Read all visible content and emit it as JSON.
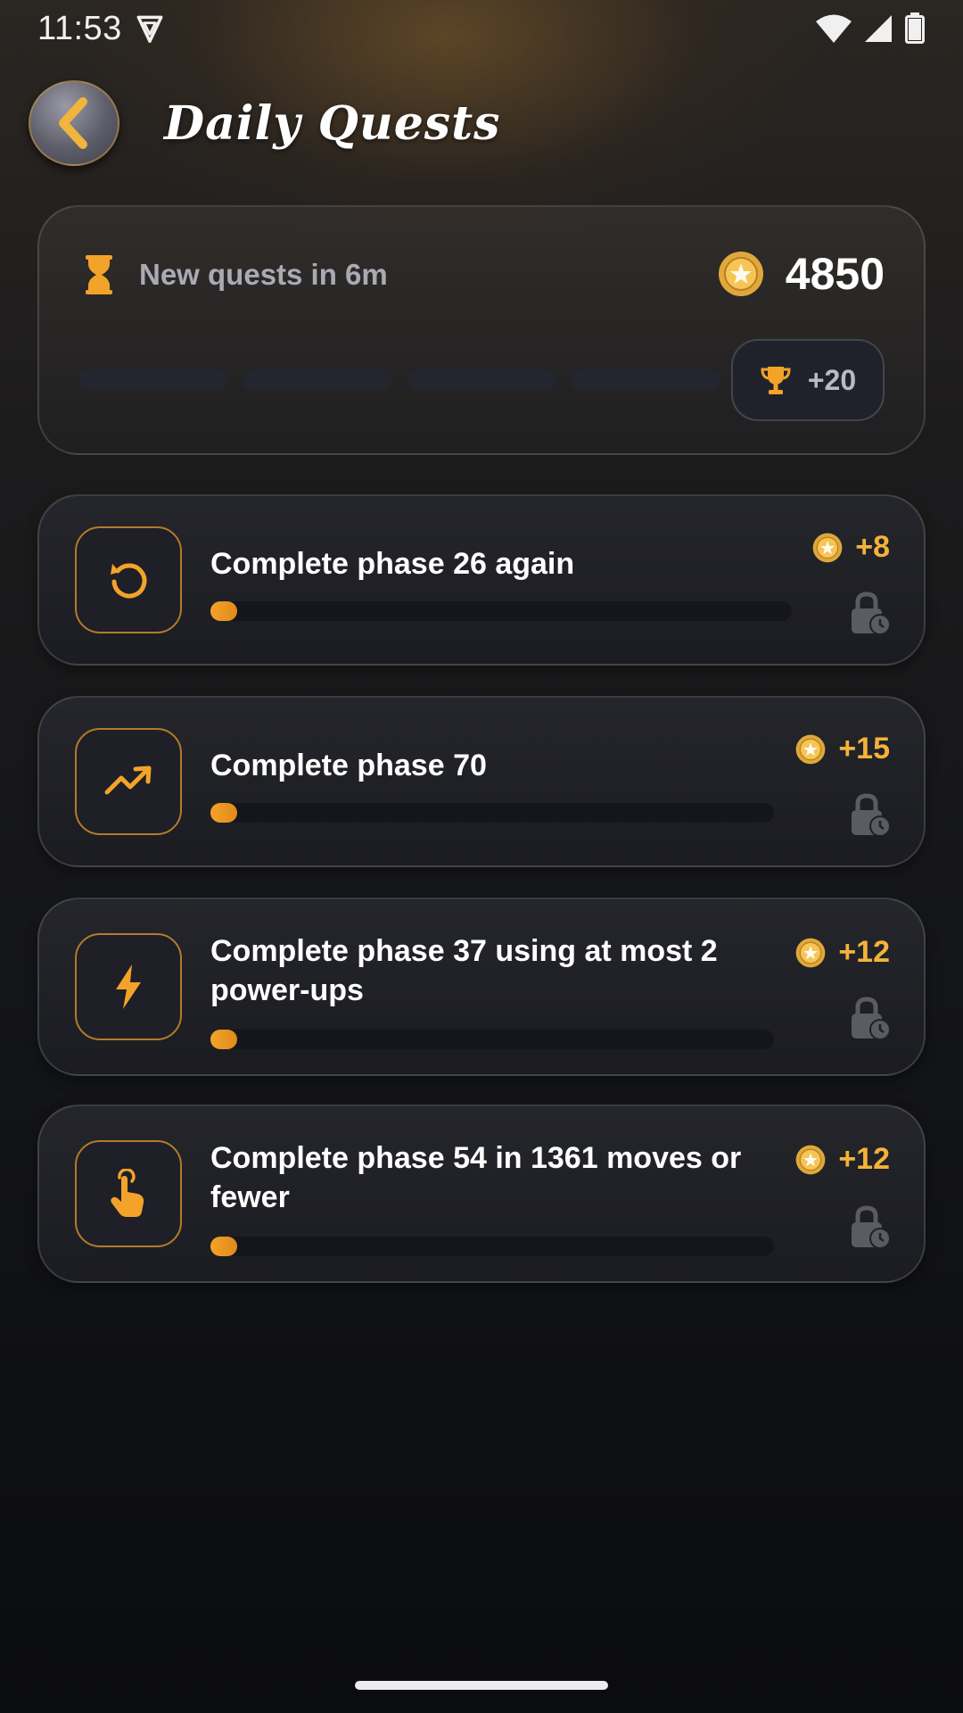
{
  "status_bar": {
    "time": "11:53"
  },
  "header": {
    "title": "Daily Quests",
    "back_icon": "chevron-left-icon"
  },
  "summary": {
    "timer_text": "New quests in 6m",
    "timer_icon": "hourglass-icon",
    "coin_balance": "4850",
    "segments_total": 4,
    "segments_completed": 0,
    "bonus_label": "+20",
    "bonus_icon": "trophy-icon"
  },
  "quests": [
    {
      "title": "Complete phase 26 again",
      "reward": "+8",
      "icon": "replay-icon",
      "progress": 0.0,
      "locked": true
    },
    {
      "title": "Complete phase 70",
      "reward": "+15",
      "icon": "trending-up-icon",
      "progress": 0.0,
      "locked": true
    },
    {
      "title": "Complete phase 37 using at most 2 power-ups",
      "reward": "+12",
      "icon": "lightning-icon",
      "progress": 0.0,
      "locked": true
    },
    {
      "title": "Complete phase 54 in 1361 moves or fewer",
      "reward": "+12",
      "icon": "tap-icon",
      "progress": 0.0,
      "locked": true
    }
  ],
  "colors": {
    "accent": "#f3a32a",
    "reward_text": "#f4b23a",
    "background": "#0c0d11"
  }
}
